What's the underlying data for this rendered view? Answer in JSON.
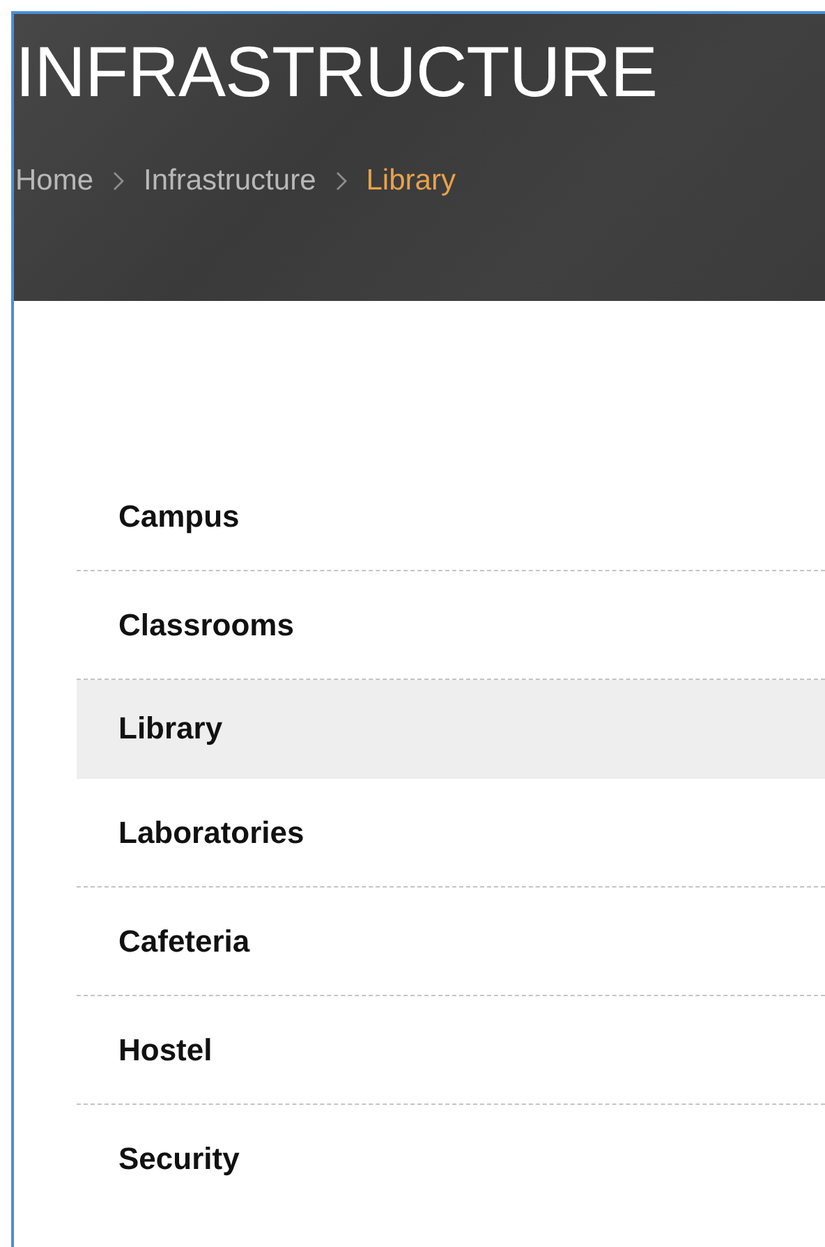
{
  "page_title": "INFRASTRUCTURE",
  "breadcrumb": [
    {
      "label": "Home",
      "current": false
    },
    {
      "label": "Infrastructure",
      "current": false
    },
    {
      "label": "Library",
      "current": true
    }
  ],
  "menu": [
    {
      "label": "Campus",
      "selected": false
    },
    {
      "label": "Classrooms",
      "selected": false
    },
    {
      "label": "Library",
      "selected": true
    },
    {
      "label": "Laboratories",
      "selected": false
    },
    {
      "label": "Cafeteria",
      "selected": false
    },
    {
      "label": "Hostel",
      "selected": false
    },
    {
      "label": "Security",
      "selected": false
    }
  ]
}
